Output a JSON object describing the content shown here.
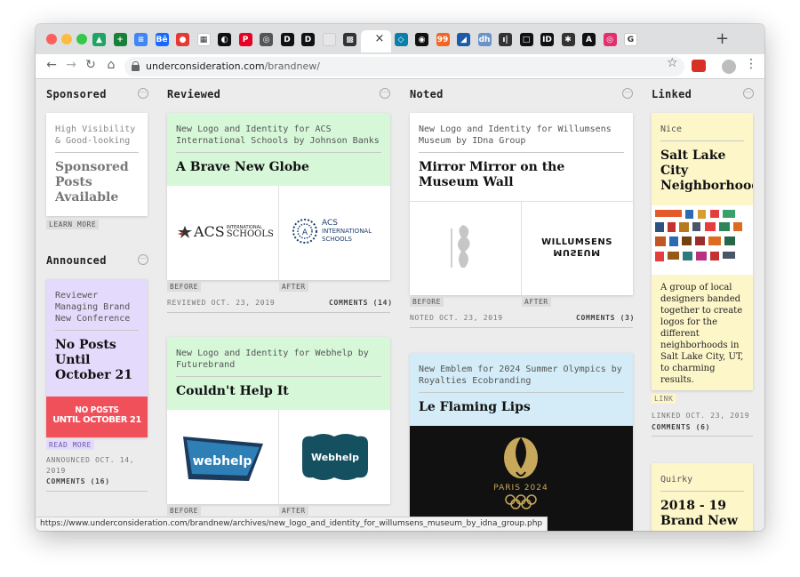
{
  "browser": {
    "url_host": "underconsideration.com",
    "url_path": "/brandnew/",
    "status_url": "https://www.underconsideration.com/brandnew/archives/new_logo_and_identity_for_willumsens_museum_by_idna_group.php",
    "tabs": [
      {
        "icon": "google-drive-icon",
        "color": "#1fa463",
        "glyph": "▲"
      },
      {
        "icon": "sheets-plus-icon",
        "color": "#188038",
        "glyph": "+"
      },
      {
        "icon": "docs-icon",
        "color": "#4285f4",
        "glyph": "≡"
      },
      {
        "icon": "behance-icon",
        "color": "#1769ff",
        "glyph": "Bē"
      },
      {
        "icon": "red-dot-icon",
        "color": "#e53935",
        "glyph": "●"
      },
      {
        "icon": "grid-icon",
        "color": "#ffffff",
        "glyph": "▦"
      },
      {
        "icon": "circle-logo-icon",
        "color": "#111111",
        "glyph": "◐"
      },
      {
        "icon": "pinterest-icon",
        "color": "#e60023",
        "glyph": "P"
      },
      {
        "icon": "globe-icon",
        "color": "#555555",
        "glyph": "◎"
      },
      {
        "icon": "d-logo-icon",
        "color": "#111111",
        "glyph": "D"
      },
      {
        "icon": "d-circle-icon",
        "color": "#111111",
        "glyph": "D"
      },
      {
        "icon": "blank-icon",
        "color": "#e6e6e6",
        "glyph": ""
      },
      {
        "icon": "pattern-icon",
        "color": "#333333",
        "glyph": "▩"
      },
      {
        "icon": "brandnew-icon",
        "color": "#ffffff",
        "glyph": ""
      },
      {
        "icon": "diamond-icon",
        "color": "#0b7fab",
        "glyph": "◇"
      },
      {
        "icon": "record-icon",
        "color": "#111111",
        "glyph": "◉"
      },
      {
        "icon": "99-icon",
        "color": "#f26522",
        "glyph": "99"
      },
      {
        "icon": "slash-icon",
        "color": "#1e5aa8",
        "glyph": "◢"
      },
      {
        "icon": "dh-icon",
        "color": "#6a93c7",
        "glyph": "dh"
      },
      {
        "icon": "bars-icon",
        "color": "#333333",
        "glyph": "ı|"
      },
      {
        "icon": "square-icon",
        "color": "#111111",
        "glyph": "□"
      },
      {
        "icon": "id-icon",
        "color": "#111111",
        "glyph": "ID"
      },
      {
        "icon": "figure-icon",
        "color": "#333333",
        "glyph": "✱"
      },
      {
        "icon": "a-icon",
        "color": "#111111",
        "glyph": "A"
      },
      {
        "icon": "instagram-icon",
        "color": "#e1306c",
        "glyph": "◎"
      },
      {
        "icon": "google-icon",
        "color": "#ffffff",
        "glyph": "G"
      }
    ]
  },
  "columns": {
    "sponsored": {
      "heading": "Sponsored"
    },
    "reviewed": {
      "heading": "Reviewed"
    },
    "noted": {
      "heading": "Noted"
    },
    "linked": {
      "heading": "Linked"
    },
    "announced": {
      "heading": "Announced"
    }
  },
  "sponsored_card": {
    "kicker": "High Visibility & Good-looking",
    "title": "Sponsored Posts Available",
    "cta": "LEARN MORE"
  },
  "announced_card": {
    "kicker": "Reviewer Managing Brand New Conference",
    "title": "No Posts Until October 21",
    "banner_line1": "NO POSTS",
    "banner_line2": "UNTIL OCTOBER 21",
    "cta": "READ MORE",
    "meta": "ANNOUNCED OCT. 14, 2019",
    "comments": "COMMENTS (16)"
  },
  "reviewed_cards": [
    {
      "kicker": "New Logo and Identity for ACS International Schools by Johnson Banks",
      "title": "A Brave New Globe",
      "before_label": "BEFORE",
      "after_label": "AFTER",
      "before_logo": "ACS",
      "before_logo_sub1": "INTERNATIONAL",
      "before_logo_sub2": "SCHOOLS",
      "after_logo_line1": "ACS",
      "after_logo_line2": "INTERNATIONAL",
      "after_logo_line3": "SCHOOLS",
      "meta": "REVIEWED OCT. 23, 2019",
      "comments": "COMMENTS (14)"
    },
    {
      "kicker": "New Logo and Identity for Webhelp by Futurebrand",
      "title": "Couldn't Help It",
      "before_label": "BEFORE",
      "after_label": "AFTER",
      "before_logo": "webhelp",
      "after_logo": "Webhelp"
    }
  ],
  "noted_cards": [
    {
      "kicker": "New Logo and Identity for Willumsens Museum by IDna Group",
      "title": "Mirror Mirror on the Museum Wall",
      "before_label": "BEFORE",
      "after_label": "AFTER",
      "after_logo_line1": "WILLUMSENS",
      "after_logo_line2": "MUSEUM",
      "meta": "NOTED OCT. 23, 2019",
      "comments": "COMMENTS (3)"
    },
    {
      "kicker": "New Emblem for 2024 Summer Olympics by Royalties Ecobranding",
      "title": "Le Flaming Lips",
      "emblem_text": "PARIS 2024"
    }
  ],
  "linked_cards": [
    {
      "kicker": "Nice",
      "title": "Salt Lake City Neighborhoods",
      "body": "A group of local designers banded together to create logos for the different neighborhoods in Salt Lake City, UT, to charming results.",
      "cta": "LINK",
      "meta": "LINKED OCT. 23, 2019",
      "comments": "COMMENTS (6)"
    },
    {
      "kicker": "Quirky",
      "title": "2018 - 19 Brand New"
    }
  ],
  "colors": {
    "reviewed_bg": "#d7f7d9",
    "noted_bg": "#d3ecf7",
    "linked_bg": "#fdf6c9",
    "announced_bg": "#e4dafc",
    "banner_red": "#f0505a"
  }
}
